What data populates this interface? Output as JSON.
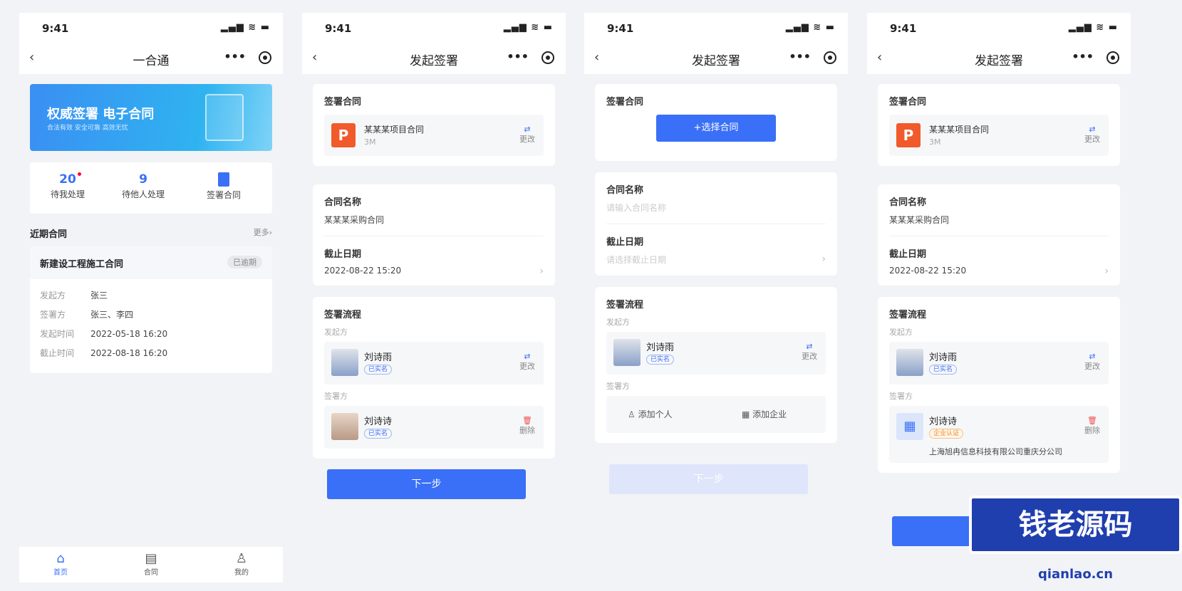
{
  "status_time": "9:41",
  "status_icons": "▂▄▆ ≋ ▬",
  "screen1": {
    "title": "一合通",
    "banner": {
      "title": "权威签署 电子合同",
      "subtitle": "合法有效 安全可靠 高效无忧"
    },
    "stats": [
      {
        "value": "20",
        "label": "待我处理"
      },
      {
        "value": "9",
        "label": "待他人处理"
      },
      {
        "value": "",
        "label": "签署合同"
      }
    ],
    "recent_title": "近期合同",
    "more": "更多›",
    "contract": {
      "name": "新建设工程施工合同",
      "status": "已逾期",
      "rows": [
        {
          "k": "发起方",
          "v": "张三"
        },
        {
          "k": "签署方",
          "v": "张三、李四"
        },
        {
          "k": "发起时间",
          "v": "2022-05-18 16:20"
        },
        {
          "k": "截止时间",
          "v": "2022-08-18 16:20"
        }
      ]
    },
    "tabs": [
      "首页",
      "合同",
      "我的"
    ]
  },
  "flow": {
    "title": "发起签署",
    "sign_contract": "签署合同",
    "file_name": "某某某项目合同",
    "file_size": "3M",
    "change": "更改",
    "select_contract": "+选择合同",
    "contract_name_label": "合同名称",
    "contract_name_value": "某某某采购合同",
    "contract_name_ph": "请输入合同名称",
    "deadline_label": "截止日期",
    "deadline_value": "2022-08-22 15:20",
    "deadline_ph": "请选择截止日期",
    "process_label": "签署流程",
    "initiator": "发起方",
    "signer": "签署方",
    "initiator_name": "刘诗雨",
    "verified": "已实名",
    "signer_name": "刘诗诗",
    "delete": "删除",
    "add_person": "添加个人",
    "add_company": "添加企业",
    "org_badge": "企业认证",
    "company": "上海旭冉信息科技有限公司重庆分公司",
    "next": "下一步"
  },
  "watermark": "钱老源码",
  "watermark_url": "qianlao.cn"
}
